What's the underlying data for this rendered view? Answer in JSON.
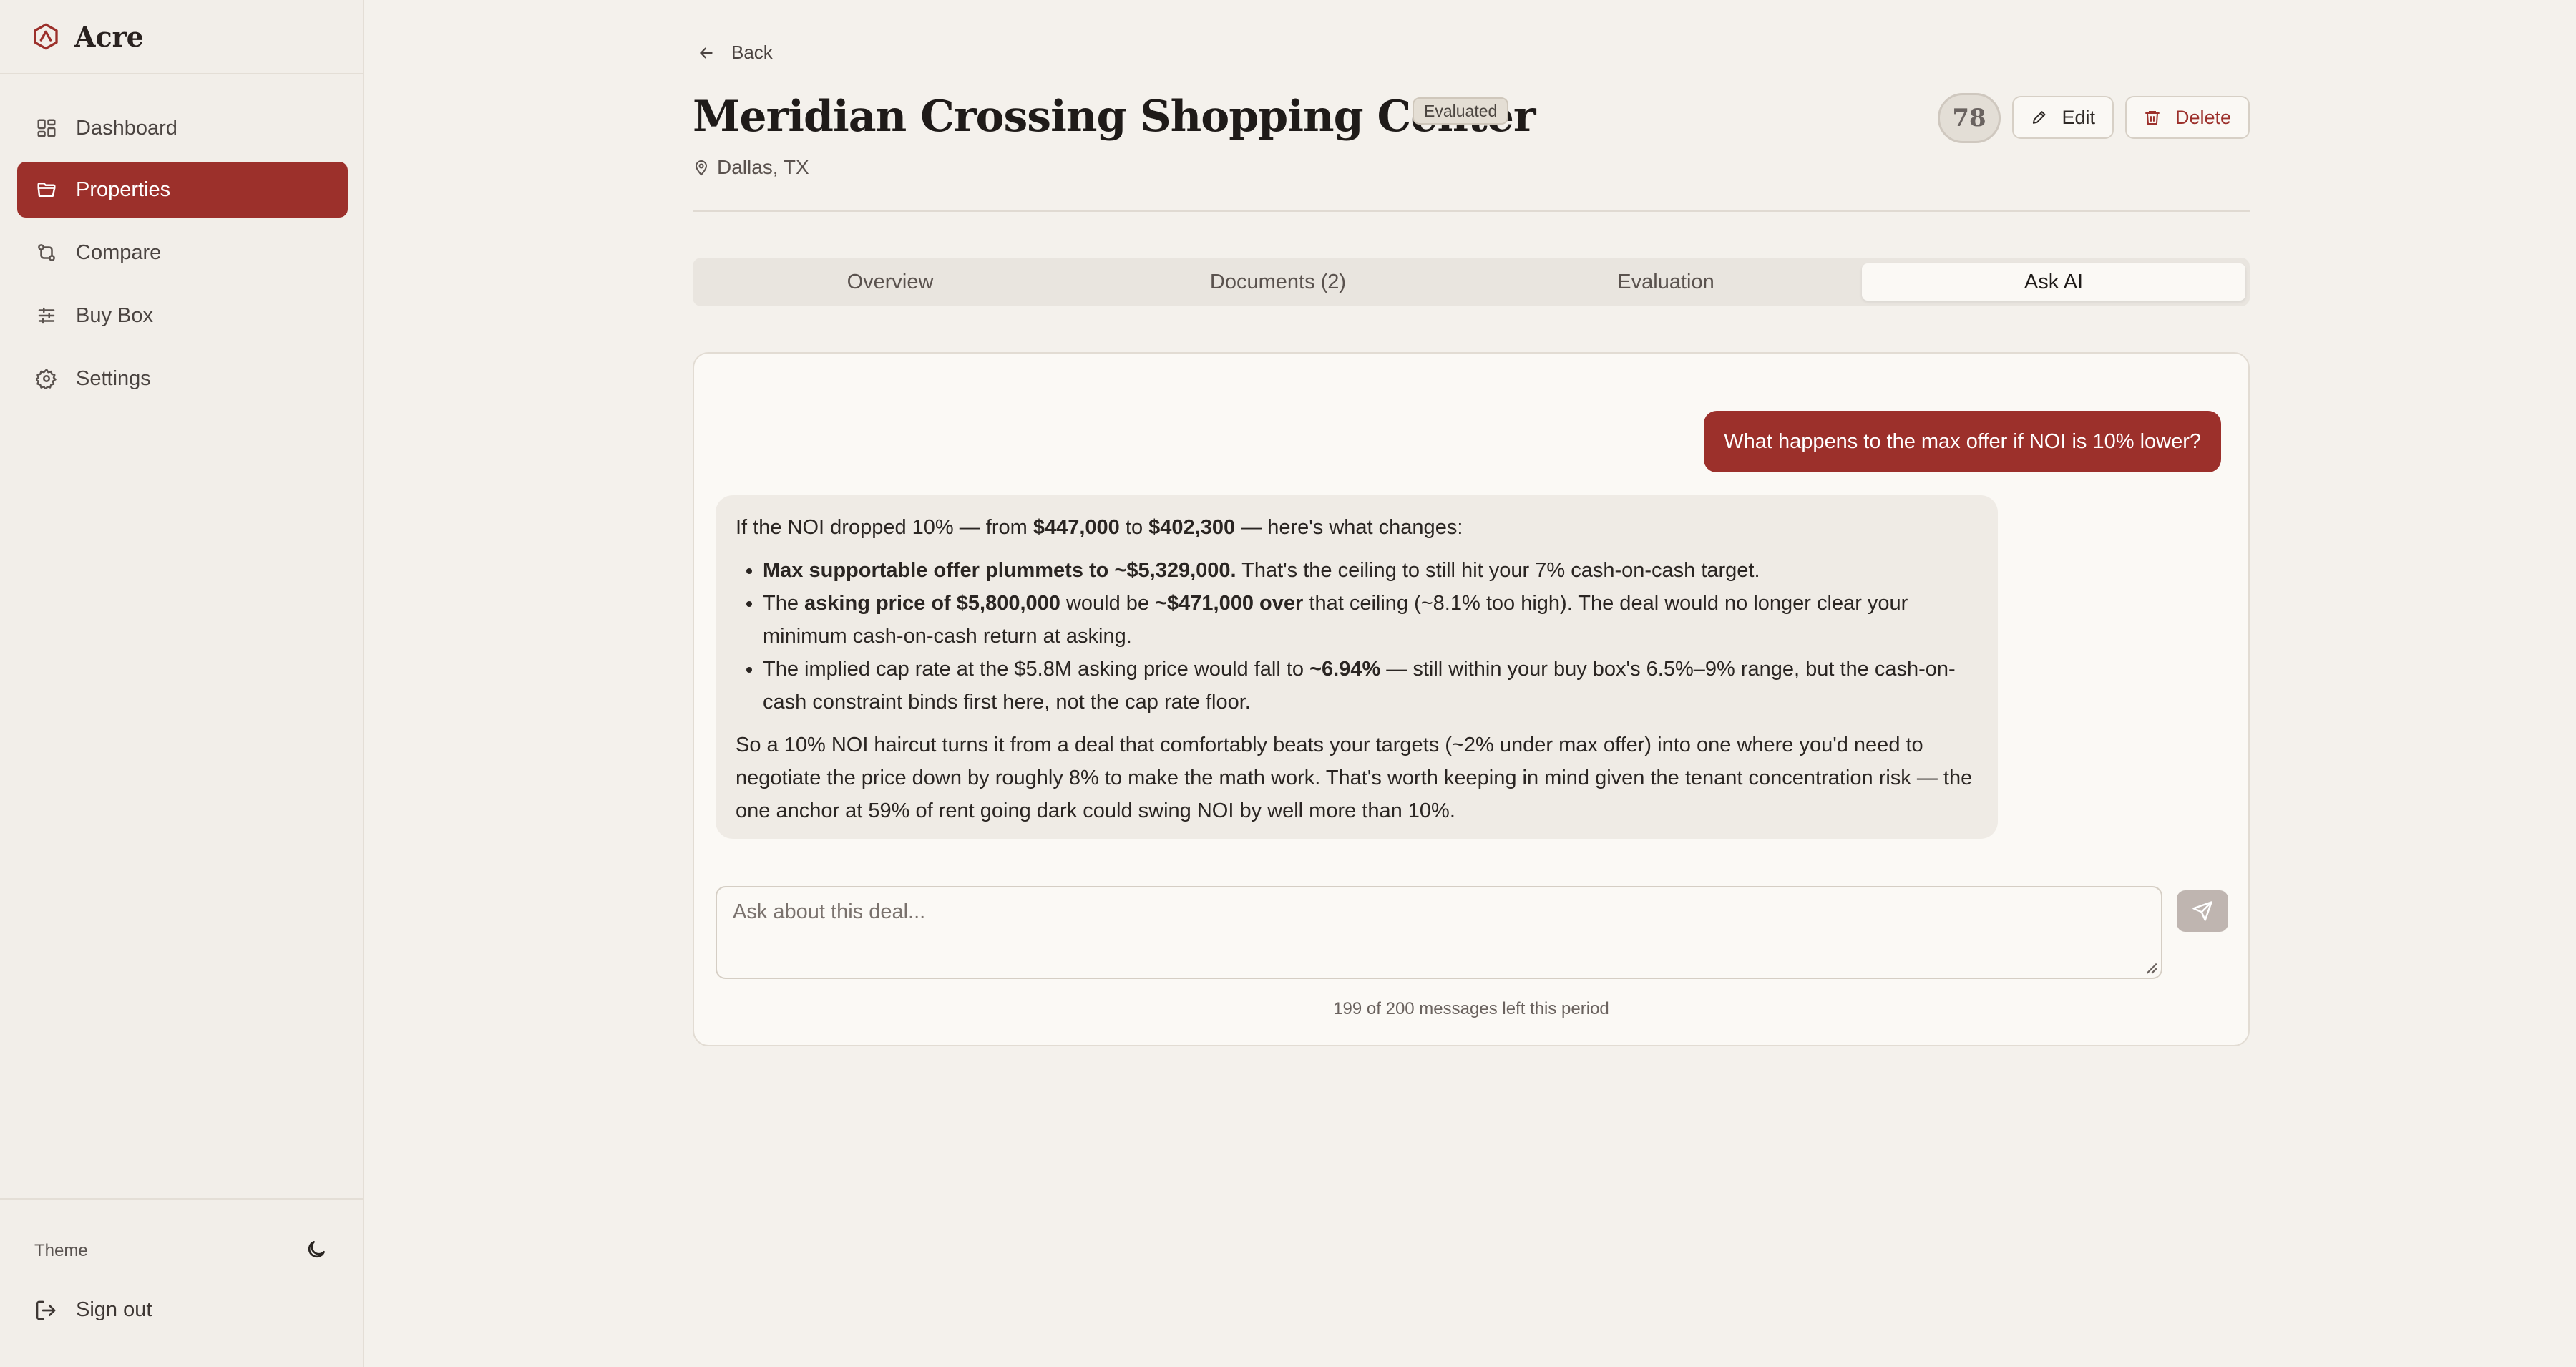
{
  "app": {
    "name": "Acre"
  },
  "sidebar": {
    "items": [
      {
        "label": "Dashboard",
        "icon": "dashboard-icon",
        "active": false
      },
      {
        "label": "Properties",
        "icon": "folder-icon",
        "active": true
      },
      {
        "label": "Compare",
        "icon": "compare-icon",
        "active": false
      },
      {
        "label": "Buy Box",
        "icon": "sliders-icon",
        "active": false
      },
      {
        "label": "Settings",
        "icon": "gear-icon",
        "active": false
      }
    ],
    "theme_label": "Theme",
    "theme_icon": "moon-icon",
    "signout_label": "Sign out"
  },
  "header": {
    "back_label": "Back",
    "title": "Meridian Crossing Shopping Center",
    "status": "Evaluated",
    "location": "Dallas, TX",
    "score": "78",
    "edit_label": "Edit",
    "delete_label": "Delete"
  },
  "tabs": [
    {
      "label": "Overview",
      "active": false
    },
    {
      "label": "Documents (2)",
      "active": false
    },
    {
      "label": "Evaluation",
      "active": false
    },
    {
      "label": "Ask AI",
      "active": true
    }
  ],
  "chat": {
    "user_message": "What happens to the max offer if NOI is 10% lower?",
    "ai": {
      "intro_1": "If the NOI dropped 10% — from ",
      "intro_b1": "$447,000",
      "intro_2": " to ",
      "intro_b2": "$402,300",
      "intro_3": " — here's what changes:",
      "b1_bold": "Max supportable offer plummets to ~$5,329,000.",
      "b1_rest": " That's the ceiling to still hit your 7% cash-on-cash target.",
      "b2_1": "The ",
      "b2_b1": "asking price of $5,800,000",
      "b2_2": " would be ",
      "b2_b2": "~$471,000 over",
      "b2_3": " that ceiling (~8.1% too high). The deal would no longer clear your minimum cash-on-cash return at asking.",
      "b3_1": "The implied cap rate at the $5.8M asking price would fall to ",
      "b3_b1": "~6.94%",
      "b3_2": " — still within your buy box's 6.5%–9% range, but the cash-on-cash constraint binds first here, not the cap rate floor.",
      "closing": "So a 10% NOI haircut turns it from a deal that comfortably beats your targets (~2% under max offer) into one where you'd need to negotiate the price down by roughly 8% to make the math work. That's worth keeping in mind given the tenant concentration risk — the one anchor at 59% of rent going dark could swing NOI by well more than 10%."
    },
    "input_placeholder": "Ask about this deal...",
    "quota_text": "199 of 200 messages left this period"
  },
  "colors": {
    "accent": "#9c302b",
    "background": "#f4f1ec"
  }
}
